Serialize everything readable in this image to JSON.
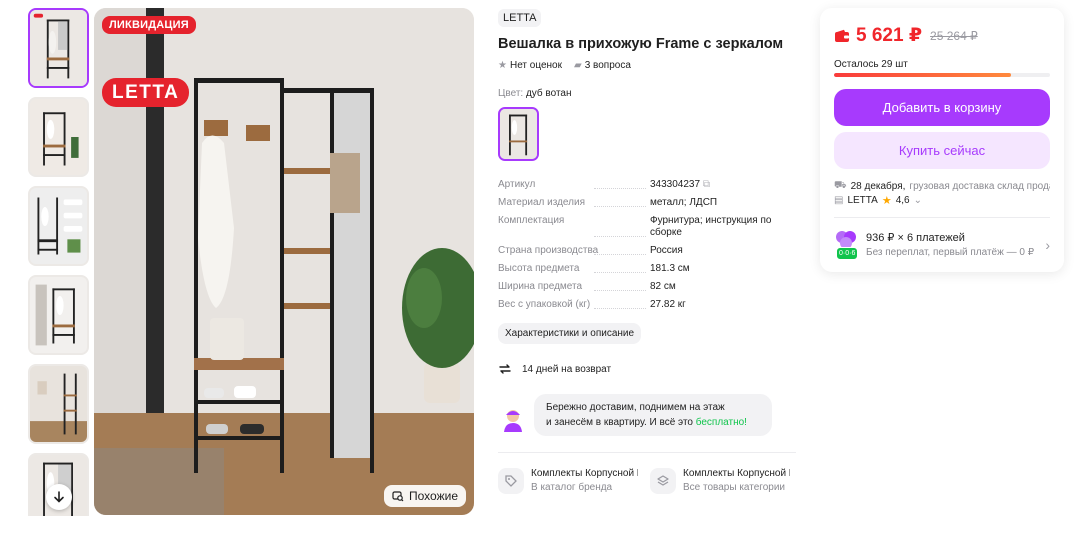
{
  "gallery": {
    "thumbnails": [
      {
        "name": "thumb-1"
      },
      {
        "name": "thumb-2"
      },
      {
        "name": "thumb-3"
      },
      {
        "name": "thumb-4"
      },
      {
        "name": "thumb-5"
      },
      {
        "name": "thumb-6"
      }
    ],
    "sale_badge": "ЛИКВИДАЦИЯ",
    "brand_logo": "LETTA",
    "similar_label": "Похожие"
  },
  "product": {
    "brand": "LETTA",
    "title": "Вешалка в прихожую Frame с зеркалом",
    "rating_text": "Нет оценок",
    "questions_text": "3 вопроса",
    "color_label": "Цвет:",
    "color_value": "дуб вотан",
    "specs": [
      {
        "key": "Артикул",
        "value": "343304237"
      },
      {
        "key": "Материал изделия",
        "value": "металл; ЛДСП"
      },
      {
        "key": "Комплектация",
        "value": "Фурнитура; инструкция по сборке"
      },
      {
        "key": "Страна производства",
        "value": "Россия"
      },
      {
        "key": "Высота предмета",
        "value": "181.3 см"
      },
      {
        "key": "Ширина предмета",
        "value": "82 см"
      },
      {
        "key": "Вес с упаковкой (кг)",
        "value": "27.82 кг"
      }
    ],
    "specs_link": "Характеристики и описание",
    "return_text": "14 дней на возврат"
  },
  "delivery_note": {
    "line1": "Бережно доставим, поднимем на этаж",
    "line2_prefix": "и занесём в квартиру. И всё это ",
    "line2_highlight": "бесплатно!"
  },
  "categories": [
    {
      "title": "Комплекты Корпусной Мебели",
      "subtitle": "В каталог бренда"
    },
    {
      "title": "Комплекты Корпусной Мебели",
      "subtitle": "Все товары категории"
    }
  ],
  "buy_box": {
    "price": "5 621 ₽",
    "old_price": "25 264 ₽",
    "stock_text": "Осталось 29 шт",
    "stock_fraction": 0.82,
    "add_to_cart": "Добавить в корзину",
    "buy_now": "Купить сейчас",
    "delivery_date": "28 декабря,",
    "delivery_desc": "грузовая доставка склад продавца",
    "seller_name": "LETTA",
    "seller_rating": "4,6",
    "installment_title": "936 ₽ × 6 платежей",
    "installment_desc": "Без переплат, первый платёж — 0 ₽",
    "installment_badge": "0·0·6"
  },
  "colors": {
    "accent": "#a73afd",
    "price_red": "#f0262b",
    "sale_red": "#e5232d",
    "free_green": "#10c44c"
  }
}
